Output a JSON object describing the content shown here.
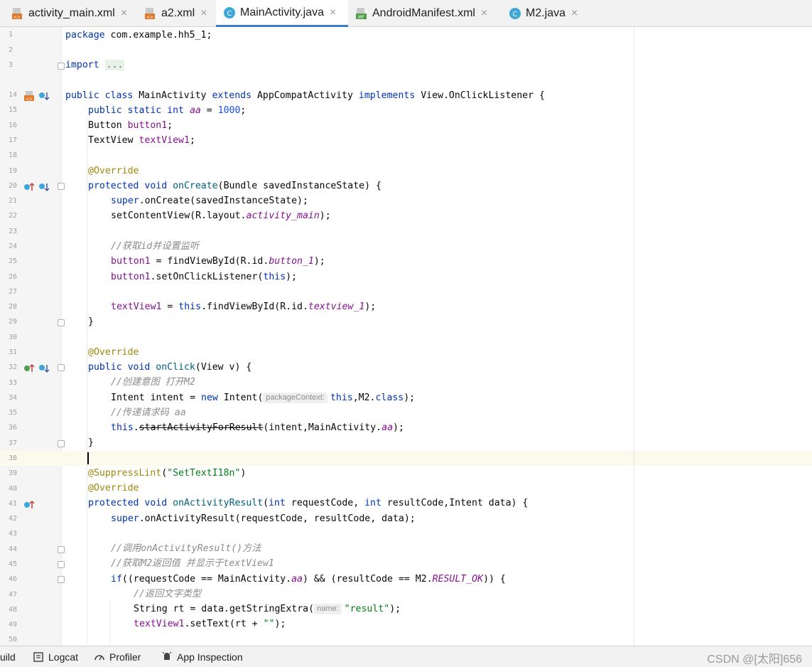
{
  "tabs": [
    {
      "label": "activity_main.xml",
      "icon": "xml-layout-icon",
      "active": false
    },
    {
      "label": "a2.xml",
      "icon": "xml-layout-icon",
      "active": false
    },
    {
      "label": "MainActivity.java",
      "icon": "java-class-icon",
      "active": true
    },
    {
      "label": "AndroidManifest.xml",
      "icon": "manifest-icon",
      "active": false
    },
    {
      "label": "M2.java",
      "icon": "java-class-icon",
      "active": false
    }
  ],
  "tab_close_glyph": "×",
  "editor": {
    "line_numbers": [
      "1",
      "2",
      "3",
      "14",
      "15",
      "16",
      "17",
      "18",
      "19",
      "20",
      "21",
      "22",
      "23",
      "24",
      "25",
      "26",
      "27",
      "28",
      "29",
      "30",
      "31",
      "32",
      "33",
      "34",
      "35",
      "36",
      "37",
      "38",
      "39",
      "40",
      "41",
      "42",
      "43",
      "44",
      "45",
      "46",
      "47",
      "48",
      "49",
      "50"
    ],
    "current_line": "38",
    "code": {
      "l1_a": "package",
      "l1_b": " com.example.hh5_1;",
      "l3_a": "import",
      "l3_b": "...",
      "l14_a": "public class",
      "l14_b": " MainActivity ",
      "l14_c": "extends",
      "l14_d": " AppCompatActivity ",
      "l14_e": "implements",
      "l14_f": " View.OnClickListener {",
      "l15_a": "public static int",
      "l15_b": "aa",
      "l15_c": " = ",
      "l15_d": "1000",
      "l15_e": ";",
      "l16_a": "Button ",
      "l16_b": "button1",
      "l16_c": ";",
      "l17_a": "TextView ",
      "l17_b": "textView1",
      "l17_c": ";",
      "l19": "@Override",
      "l20_a": "protected void",
      "l20_b": "onCreate",
      "l20_c": "(Bundle savedInstanceState) {",
      "l21_a": "super",
      "l21_b": ".onCreate(savedInstanceState);",
      "l22_a": "setContentView(R.layout.",
      "l22_b": "activity_main",
      "l22_c": ");",
      "l24": "//获取id并设置监听",
      "l25_a": "button1",
      "l25_b": " = findViewById(R.id.",
      "l25_c": "button_1",
      "l25_d": ");",
      "l26_a": "button1",
      "l26_b": ".setOnClickListener(",
      "l26_c": "this",
      "l26_d": ");",
      "l28_a": "textView1",
      "l28_b": " = ",
      "l28_c": "this",
      "l28_d": ".findViewById(R.id.",
      "l28_e": "textview_1",
      "l28_f": ");",
      "l29": "}",
      "l31": "@Override",
      "l32_a": "public void",
      "l32_b": "onClick",
      "l32_c": "(View v) {",
      "l33": "//创建意图 打开M2",
      "l34_a": "Intent intent = ",
      "l34_b": "new",
      "l34_c": " Intent(",
      "l34_hint": "packageContext:",
      "l34_d": "this",
      "l34_e": ",M2.",
      "l34_f": "class",
      "l34_g": ");",
      "l35": "//传递请求码 aa",
      "l36_a": "this",
      "l36_b": ".",
      "l36_c": "startActivityForResult",
      "l36_d": "(intent,MainActivity.",
      "l36_e": "aa",
      "l36_f": ");",
      "l37": "}",
      "l39_a": "@SuppressLint",
      "l39_b": "(",
      "l39_c": "\"SetTextI18n\"",
      "l39_d": ")",
      "l40": "@Override",
      "l41_a": "protected void",
      "l41_b": "onActivityResult",
      "l41_c": "(",
      "l41_d": "int",
      "l41_e": " requestCode, ",
      "l41_f": "int",
      "l41_g": " resultCode,Intent data) {",
      "l42_a": "super",
      "l42_b": ".onActivityResult(requestCode, resultCode, data);",
      "l44": "//调用onActivityResult()方法",
      "l45": "//获取M2返回值 并显示于textView1",
      "l46_a": "if",
      "l46_b": "((requestCode == MainActivity.",
      "l46_c": "aa",
      "l46_d": ") && (resultCode == M2.",
      "l46_e": "RESULT_OK",
      "l46_f": ")) {",
      "l47": "//返回文字类型",
      "l48_a": "String rt = data.getStringExtra(",
      "l48_hint": "name:",
      "l48_b": "\"result\"",
      "l48_c": ");",
      "l49_a": "textView1",
      "l49_b": ".setText(rt + ",
      "l49_c": "\"\"",
      "l49_d": ");"
    }
  },
  "bottom_bar": {
    "items": [
      {
        "label": "uild",
        "icon": ""
      },
      {
        "label": "Logcat",
        "icon": "logcat-icon"
      },
      {
        "label": "Profiler",
        "icon": "profiler-icon"
      },
      {
        "label": "App Inspection",
        "icon": "app-inspection-icon"
      }
    ],
    "watermark": "CSDN @[太阳]656"
  },
  "colors": {
    "keyword": "#0033b3",
    "field": "#871094",
    "number": "#1750eb",
    "string": "#067d17",
    "annotation": "#9e880d",
    "comment": "#8c8c8c",
    "method": "#00627a",
    "active_tab_underline": "#3d7bd3",
    "current_line_bg": "#fcfaed"
  }
}
